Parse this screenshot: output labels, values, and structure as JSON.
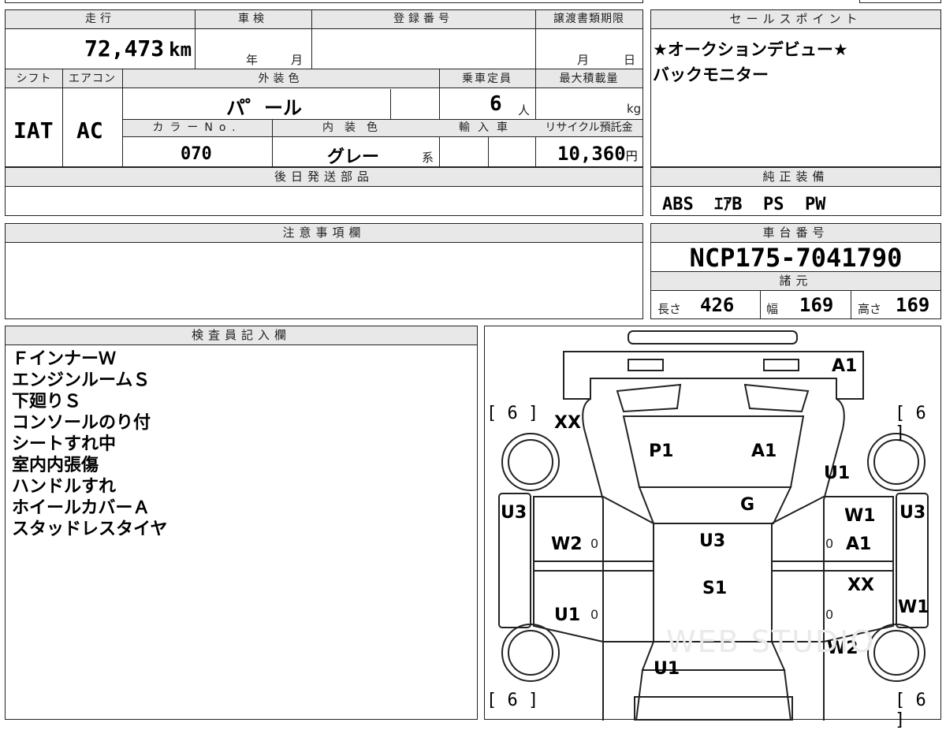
{
  "top": {
    "mileage_label": "走行",
    "mileage": "72,473",
    "mileage_unit": "km",
    "inspection_label": "車検",
    "inspection_year": "年",
    "inspection_month": "月",
    "registration_label": "登録番号",
    "registration_value": "",
    "transfer_deadline_label": "譲渡書類期限",
    "transfer_month": "月",
    "transfer_day": "日"
  },
  "mid": {
    "shift_label": "シフト",
    "shift": "IAT",
    "aircon_label": "エアコン",
    "aircon": "AC",
    "exterior_color_label": "外装色",
    "exterior_color": "パ゜ール",
    "color_no_label": "カラーNo.",
    "color_no": "070",
    "interior_color_label": "内装色",
    "interior_color": "グレー",
    "interior_color_suffix": "系",
    "capacity_label": "乗車定員",
    "capacity": "6",
    "capacity_unit": "人",
    "max_load_label": "最大積載量",
    "max_load_unit": "kg",
    "import_label": "輸入車",
    "recycle_label": "リサイクル預託金",
    "recycle_fee": "10,360",
    "recycle_unit": "円"
  },
  "later_parts": {
    "label": "後日発送部品",
    "value": ""
  },
  "sales_points": {
    "label": "セールスポイント",
    "lines": [
      "★オークションデビュー★",
      "バックモニター"
    ]
  },
  "genuine_equipment": {
    "label": "純正装備",
    "value": "ABS  ｴｱB  PS  PW"
  },
  "caution": {
    "label": "注意事項欄",
    "value": ""
  },
  "chassis": {
    "label": "車台番号",
    "value": "NCP175-7041790"
  },
  "specs": {
    "label": "諸元",
    "length_label": "長さ",
    "length": "426",
    "width_label": "幅",
    "width": "169",
    "height_label": "高さ",
    "height": "169"
  },
  "inspector": {
    "label": "検査員記入欄",
    "notes": [
      "ＦインナーＷ",
      "エンジンルームＳ",
      "下廻りＳ",
      "コンソールのり付",
      "シートすれ中",
      "室内内張傷",
      "ハンドルすれ",
      "ホイールカバーＡ",
      "スタッドレスタイヤ"
    ]
  },
  "diagram": {
    "tire_fl": "[ 6 ]",
    "tire_fr": "[ 6 ]",
    "tire_rl": "[ 6 ]",
    "tire_rr": "[ 6 ]",
    "front_bumper": "A1",
    "front_left_fender": "XX",
    "hood_left": "P1",
    "hood_right": "A1",
    "front_right_fender": "U1",
    "roof_front": "G",
    "left_pillar": "U3",
    "right_pillar": "U3",
    "left_front_door": "W2",
    "right_front_door_top": "W1",
    "right_front_door": "A1",
    "roof": "U3",
    "roof_rear": "S1",
    "left_rear_door": "U1",
    "right_rear_door": "XX",
    "right_rear_pillar": "W1",
    "right_rear_fender": "W2",
    "rear_hatch": "U1",
    "door_mark_l1": "0",
    "door_mark_l2": "0",
    "door_mark_r1": "0",
    "door_mark_r2": "0",
    "watermark": "WEB STUDIO"
  }
}
